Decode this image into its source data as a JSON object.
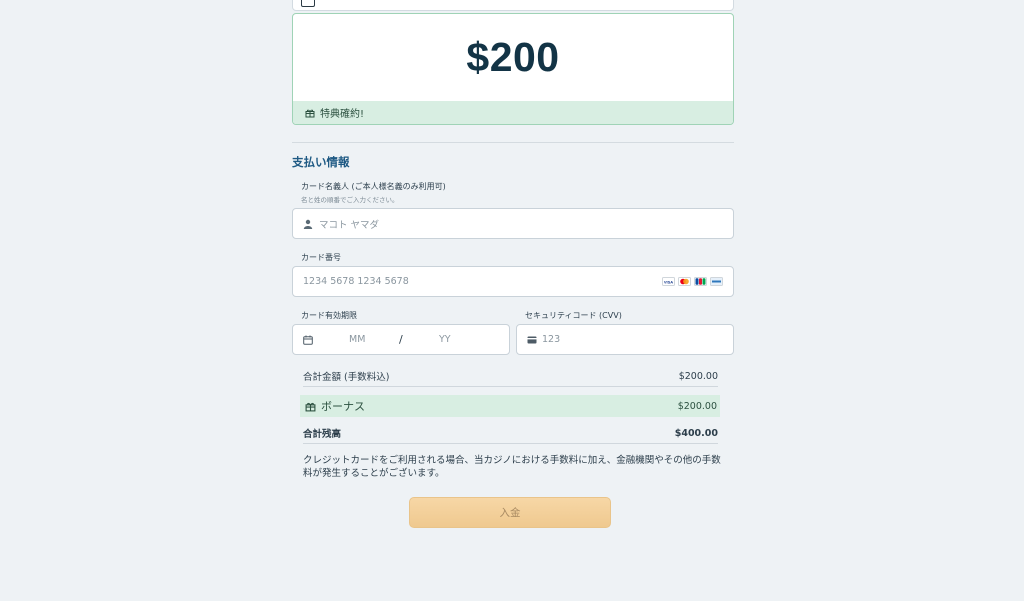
{
  "amount_card": {
    "value": "$200",
    "bonus_label": "特典確約!"
  },
  "payment": {
    "section_title": "支払い情報",
    "cardholder": {
      "label": "カード名義人 (ご本人様名義のみ利用可)",
      "hint": "名と姓の順番でご入力ください。",
      "placeholder": "マコト ヤマダ",
      "icon": "user-icon"
    },
    "card_number": {
      "label": "カード番号",
      "placeholder": "1234 5678 1234 5678",
      "brands": [
        "VISA",
        "Mastercard",
        "JCB",
        "AMEX"
      ]
    },
    "expiry": {
      "label": "カード有効期限",
      "month_placeholder": "MM",
      "separator": "/",
      "year_placeholder": "YY",
      "icon": "calendar-icon"
    },
    "cvv": {
      "label": "セキュリティコード (CVV)",
      "placeholder": "123",
      "icon": "card-icon"
    }
  },
  "summary": {
    "total_label": "合計金額 (手数料込)",
    "total_value": "$200.00",
    "bonus_label": "ボーナス",
    "bonus_value": "$200.00",
    "balance_label": "合計残高",
    "balance_value": "$400.00"
  },
  "notice": "クレジットカードをご利用される場合、当カジノにおける手数料に加え、金融機関やその他の手数料が発生することがございます。",
  "deposit_button": "入金",
  "colors": {
    "accent_green": "#d8eee2",
    "title_blue": "#1f5a84",
    "button_orange": "#f3d09a"
  }
}
